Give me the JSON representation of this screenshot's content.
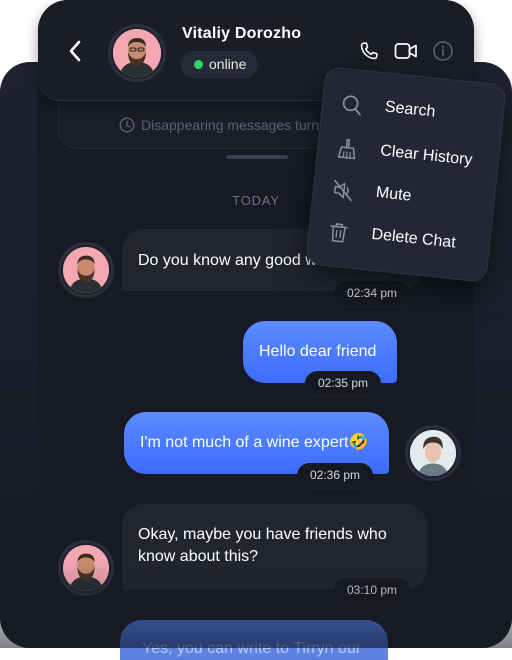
{
  "header": {
    "contact_name": "Vitaliy Dorozho",
    "status": "online",
    "icons": [
      "back-arrow-icon",
      "phone-icon",
      "video-camera-icon",
      "info-icon"
    ]
  },
  "notice": {
    "text": "Disappearing messages turned on",
    "icon": "clock-icon"
  },
  "date_divider": "TODAY",
  "context_menu": {
    "items": [
      {
        "label": "Search",
        "icon": "search-icon"
      },
      {
        "label": "Clear History",
        "icon": "broom-icon"
      },
      {
        "label": "Mute",
        "icon": "muted-speaker-icon"
      },
      {
        "label": "Delete Chat",
        "icon": "trash-icon"
      }
    ]
  },
  "messages": [
    {
      "direction": "incoming",
      "text": "Do you know any good wine?",
      "time": "02:34 pm"
    },
    {
      "direction": "outgoing",
      "text": "Hello dear friend",
      "time": "02:35 pm"
    },
    {
      "direction": "outgoing",
      "text": "I'm not much of a wine expert🤣",
      "time": "02:36 pm"
    },
    {
      "direction": "incoming",
      "lines": [
        "Okay, maybe you have friends who",
        "know about this?"
      ],
      "time": "03:10 pm"
    },
    {
      "direction": "outgoing",
      "text": "Yes, you can write to Tirryn our"
    }
  ],
  "colors": {
    "background": "#171a24",
    "incoming_bubble": "#22252f",
    "outgoing_bubble": "#4a7bff",
    "online_dot": "#33d36b"
  }
}
